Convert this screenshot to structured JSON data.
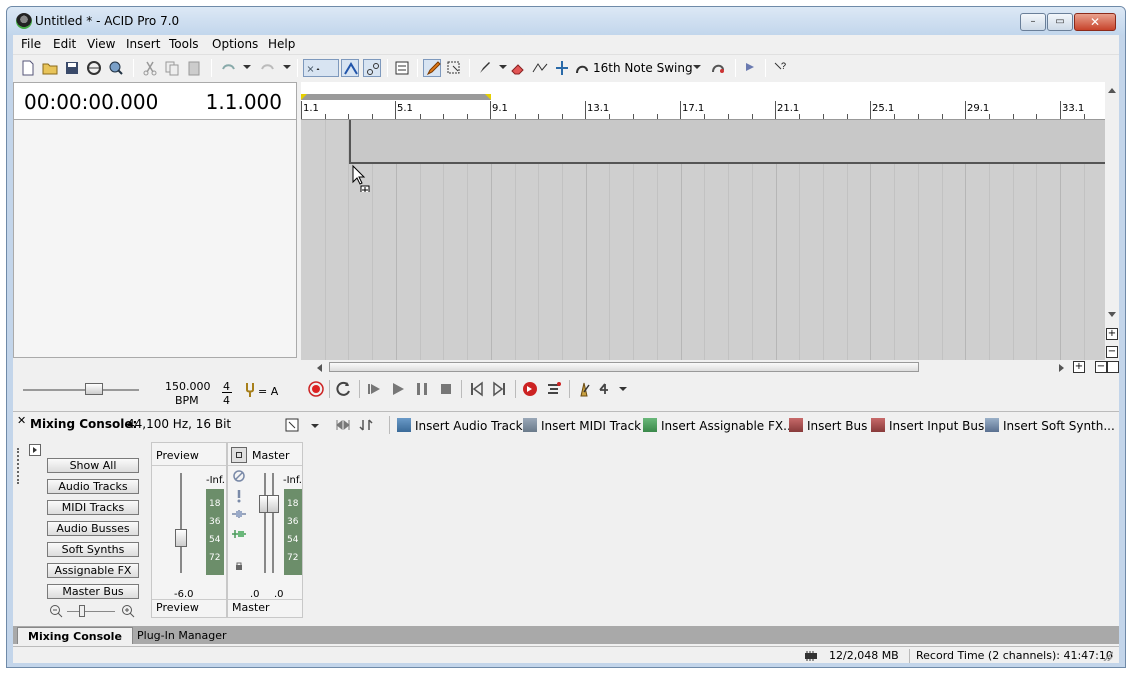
{
  "window": {
    "title": "Untitled * - ACID Pro 7.0",
    "controls": {
      "minimize": "–",
      "maximize": "▭",
      "close": "✕"
    }
  },
  "menu": [
    "File",
    "Edit",
    "View",
    "Insert",
    "Tools",
    "Options",
    "Help"
  ],
  "toolbar": {
    "swing": "16th Note Swing"
  },
  "time_display": {
    "time": "00:00:00.000",
    "measure": "1.1.000"
  },
  "ruler": {
    "labels": [
      "1.1",
      "5.1",
      "9.1",
      "13.1",
      "17.1",
      "21.1",
      "25.1",
      "29.1",
      "33.1"
    ]
  },
  "tempo": {
    "bpm_value": "150.000",
    "bpm_label": "BPM",
    "time_sig_top": "4",
    "time_sig_bottom": "4",
    "key": "= A"
  },
  "mixer": {
    "title": "Mixing Console:",
    "format": "44,100 Hz, 16 Bit",
    "actions": [
      "Insert Audio Track",
      "Insert MIDI Track",
      "Insert Assignable FX...",
      "Insert Bus",
      "Insert Input Bus",
      "Insert Soft Synth..."
    ],
    "filters": [
      "Show All",
      "Audio Tracks",
      "MIDI Tracks",
      "Audio Busses",
      "Soft Synths",
      "Assignable FX",
      "Master Bus"
    ],
    "preview": {
      "label": "Preview",
      "level": "-Inf.",
      "gain": "-6.0",
      "footer": "Preview"
    },
    "master": {
      "label": "Master",
      "level": "-Inf.",
      "left": ".0",
      "right": ".0",
      "footer": "Master"
    },
    "meter_scale": [
      "18",
      "36",
      "54",
      "72"
    ]
  },
  "tabs": [
    "Mixing Console",
    "Plug-In Manager"
  ],
  "status": {
    "memory": "12/2,048 MB",
    "record_time": "Record Time (2 channels): 41:47:10"
  }
}
